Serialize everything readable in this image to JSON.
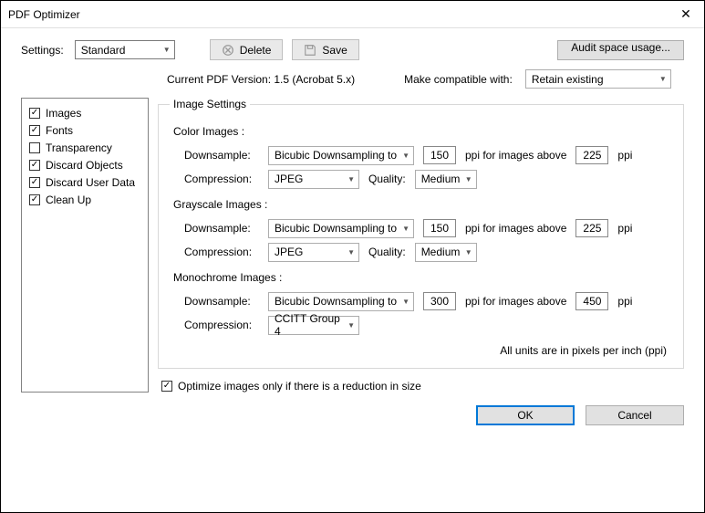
{
  "title": "PDF Optimizer",
  "toolbar": {
    "settings_label": "Settings:",
    "settings_value": "Standard",
    "delete": "Delete",
    "save": "Save",
    "audit": "Audit space usage..."
  },
  "version": {
    "current_label": "Current PDF Version: 1.5 (Acrobat 5.x)",
    "compat_label": "Make compatible with:",
    "compat_value": "Retain existing"
  },
  "sidebar": [
    {
      "label": "Images",
      "checked": true
    },
    {
      "label": "Fonts",
      "checked": true
    },
    {
      "label": "Transparency",
      "checked": false
    },
    {
      "label": "Discard Objects",
      "checked": true
    },
    {
      "label": "Discard User Data",
      "checked": true
    },
    {
      "label": "Clean Up",
      "checked": true
    }
  ],
  "panel": {
    "legend": "Image Settings",
    "labels": {
      "downsample": "Downsample:",
      "compression": "Compression:",
      "quality": "Quality:",
      "above": "ppi for images above",
      "ppi": "ppi"
    },
    "color": {
      "header": "Color Images :",
      "ds": "Bicubic Downsampling to",
      "v1": "150",
      "v2": "225",
      "comp": "JPEG",
      "qual": "Medium"
    },
    "gray": {
      "header": "Grayscale Images :",
      "ds": "Bicubic Downsampling to",
      "v1": "150",
      "v2": "225",
      "comp": "JPEG",
      "qual": "Medium"
    },
    "mono": {
      "header": "Monochrome Images :",
      "ds": "Bicubic Downsampling to",
      "v1": "300",
      "v2": "450",
      "comp": "CCITT Group 4"
    },
    "note": "All units are in pixels per inch (ppi)"
  },
  "optimize": {
    "label": "Optimize images only if there is a reduction in size",
    "checked": true
  },
  "footer": {
    "ok": "OK",
    "cancel": "Cancel"
  }
}
